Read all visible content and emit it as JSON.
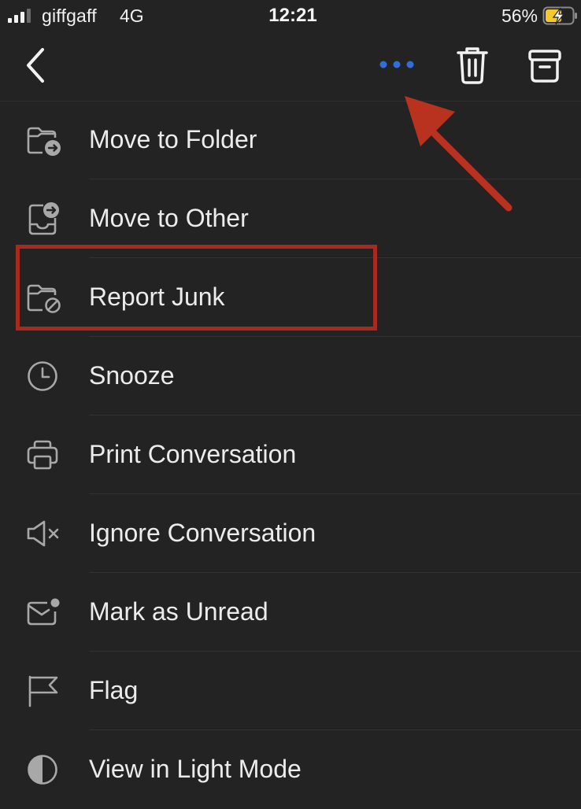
{
  "status_bar": {
    "carrier": "giffgaff",
    "network": "4G",
    "time": "12:21",
    "battery_percent": "56%"
  },
  "nav_bar": {
    "icons": [
      "chevron-left-icon",
      "more-horizontal-icon",
      "trash-icon",
      "archive-icon"
    ],
    "more_color": "#2f6fd8"
  },
  "menu": {
    "items": [
      {
        "label": "Move to Folder",
        "icon": "folder-move-icon"
      },
      {
        "label": "Move to Other",
        "icon": "inbox-move-icon"
      },
      {
        "label": "Report Junk",
        "icon": "folder-block-icon"
      },
      {
        "label": "Snooze",
        "icon": "clock-icon"
      },
      {
        "label": "Print Conversation",
        "icon": "printer-icon"
      },
      {
        "label": "Ignore Conversation",
        "icon": "speaker-mute-icon"
      },
      {
        "label": "Mark as Unread",
        "icon": "mail-unread-icon"
      },
      {
        "label": "Flag",
        "icon": "flag-icon"
      },
      {
        "label": "View in Light Mode",
        "icon": "contrast-icon"
      }
    ]
  },
  "annotation": {
    "highlight_color": "#a82a1f",
    "arrow_color": "#b8321f"
  }
}
